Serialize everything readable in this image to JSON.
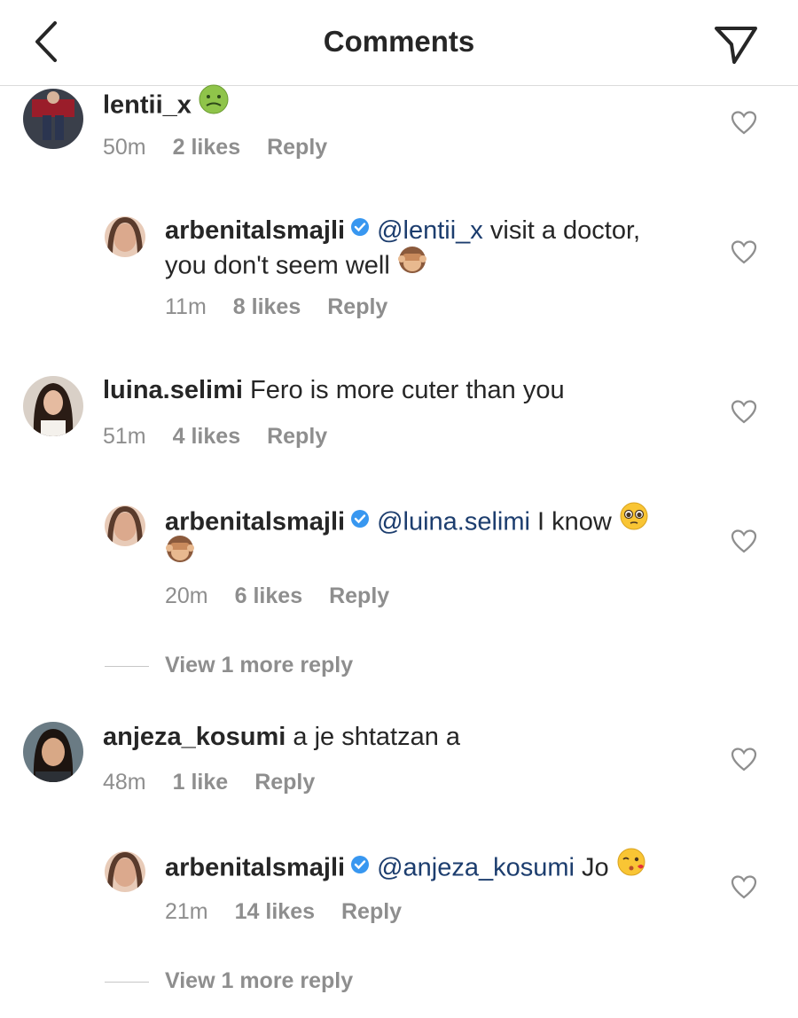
{
  "header": {
    "title": "Comments"
  },
  "comments": [
    {
      "username": "lentii_x",
      "text": "",
      "time": "50m",
      "likes": "2 likes",
      "reply": "Reply",
      "replies": [
        {
          "username": "arbenitalsmajli",
          "mention": "@lentii_x",
          "text_line1": " visit a doctor,",
          "text_line2": "you don't seem well",
          "time": "11m",
          "likes": "8 likes",
          "reply": "Reply"
        }
      ]
    },
    {
      "username": "luina.selimi",
      "text": "Fero is more cuter than you",
      "time": "51m",
      "likes": "4 likes",
      "reply": "Reply",
      "replies": [
        {
          "username": "arbenitalsmajli",
          "mention": "@luina.selimi",
          "text_line1": " I know",
          "time": "20m",
          "likes": "6 likes",
          "reply": "Reply"
        }
      ],
      "view_more": "View 1 more reply"
    },
    {
      "username": "anjeza_kosumi",
      "text": "a je shtatzan a",
      "time": "48m",
      "likes": "1 like",
      "reply": "Reply",
      "replies": [
        {
          "username": "arbenitalsmajli",
          "mention": "@anjeza_kosumi",
          "text_line1": " Jo",
          "time": "21m",
          "likes": "14 likes",
          "reply": "Reply"
        }
      ],
      "view_more": "View 1 more reply"
    }
  ],
  "colors": {
    "mention": "#1c3d6e",
    "verified": "#3897f0",
    "muted": "#8e8e8e"
  },
  "icons": [
    "back-arrow-icon",
    "send-icon",
    "heart-icon",
    "verified-badge-icon",
    "nauseated-face-emoji",
    "see-no-evil-monkey-emoji",
    "pleading-face-emoji",
    "face-blowing-kiss-emoji"
  ]
}
